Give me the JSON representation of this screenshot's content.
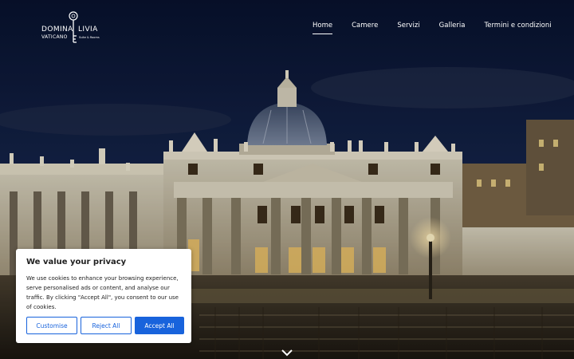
{
  "brand": {
    "word_left": "DOMINA",
    "word_right": "LIVIA",
    "subtitle": "VATICANO",
    "tagline": "Suite & Rooms"
  },
  "nav": {
    "items": [
      {
        "label": "Home",
        "active": true
      },
      {
        "label": "Camere",
        "active": false
      },
      {
        "label": "Servizi",
        "active": false
      },
      {
        "label": "Galleria",
        "active": false
      },
      {
        "label": "Termini e condizioni",
        "active": false
      }
    ]
  },
  "cookie_banner": {
    "title": "We value your privacy",
    "body": "We use cookies to enhance your browsing experience, serve personalised ads or content, and analyse our traffic. By clicking \"Accept All\", you consent to our use of cookies.",
    "customise_label": "Customise",
    "reject_label": "Reject All",
    "accept_label": "Accept All"
  },
  "icons": {
    "scroll_down": "chevron-down-icon",
    "logo_mark": "key-icon"
  },
  "colors": {
    "accent": "#1863dc",
    "sky_top": "#0b1b3f",
    "sky_bottom": "#1a2b52",
    "stone_lit": "#c9c2ae"
  }
}
